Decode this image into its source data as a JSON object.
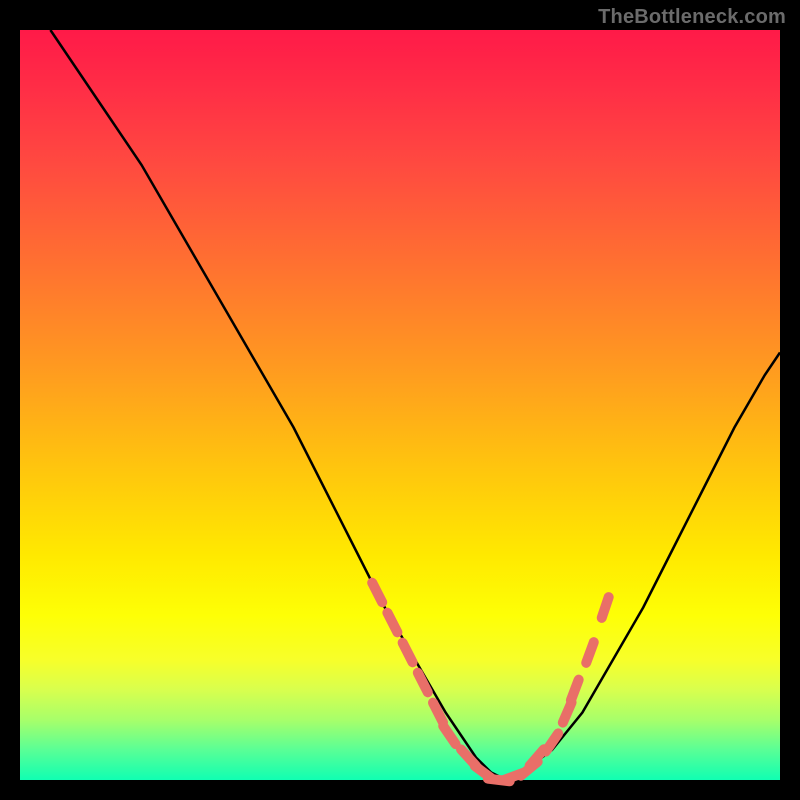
{
  "watermark": "TheBottleneck.com",
  "chart_data": {
    "type": "line",
    "title": "",
    "xlabel": "",
    "ylabel": "",
    "xlim": [
      0,
      100
    ],
    "ylim": [
      0,
      100
    ],
    "grid": false,
    "series": [
      {
        "name": "curve",
        "color": "#000000",
        "x": [
          4,
          8,
          12,
          16,
          20,
          24,
          28,
          32,
          36,
          40,
          44,
          48,
          52,
          56,
          58,
          60,
          62,
          64,
          66,
          70,
          74,
          78,
          82,
          86,
          90,
          94,
          98,
          100
        ],
        "y": [
          100,
          94,
          88,
          82,
          75,
          68,
          61,
          54,
          47,
          39,
          31,
          23,
          16,
          9,
          6,
          3,
          1,
          0,
          1,
          4,
          9,
          16,
          23,
          31,
          39,
          47,
          54,
          57
        ]
      }
    ],
    "markers": {
      "color": "#e96f68",
      "x": [
        47,
        49,
        51,
        53,
        55,
        56.5,
        59,
        61,
        63,
        65,
        67,
        68,
        70,
        72,
        73,
        75,
        77
      ],
      "y": [
        25,
        21,
        17,
        13,
        9,
        6,
        3,
        1,
        0,
        0.5,
        1.5,
        3,
        5,
        9,
        12,
        17,
        23
      ]
    },
    "gradient_stops": [
      {
        "pos": 0,
        "color": "#ff1a48"
      },
      {
        "pos": 8,
        "color": "#ff2e46"
      },
      {
        "pos": 18,
        "color": "#ff4a40"
      },
      {
        "pos": 30,
        "color": "#ff6d32"
      },
      {
        "pos": 45,
        "color": "#ff9a20"
      },
      {
        "pos": 58,
        "color": "#ffc40e"
      },
      {
        "pos": 70,
        "color": "#ffe900"
      },
      {
        "pos": 78,
        "color": "#feff06"
      },
      {
        "pos": 84,
        "color": "#f7ff2a"
      },
      {
        "pos": 88,
        "color": "#d8ff4e"
      },
      {
        "pos": 92,
        "color": "#a7ff6a"
      },
      {
        "pos": 96,
        "color": "#59ff96"
      },
      {
        "pos": 100,
        "color": "#10ffb2"
      }
    ]
  }
}
